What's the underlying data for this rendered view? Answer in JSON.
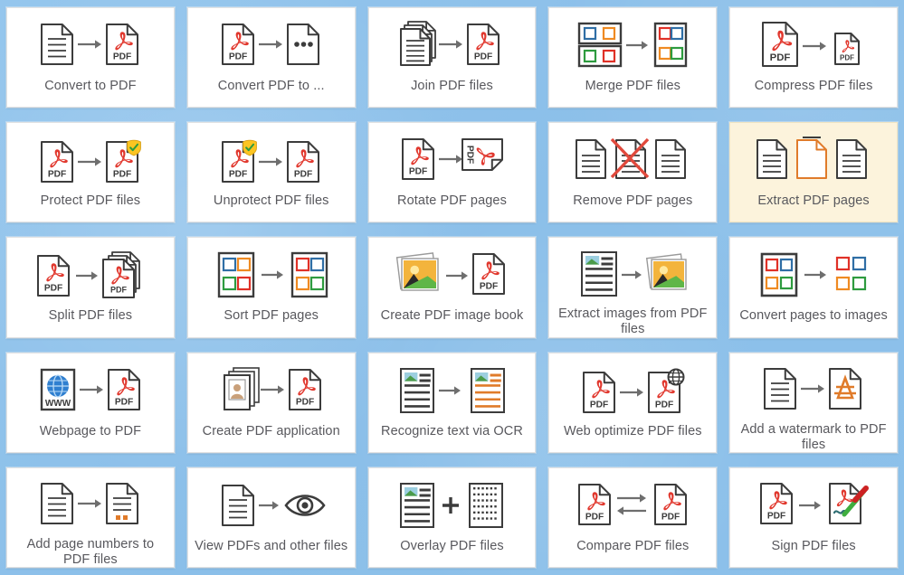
{
  "page": {
    "background_color": "#8cc0ea",
    "tile_background_color": "#ffffff",
    "selected_tile_background_color": "#fcf3dc",
    "label_color": "#58585d",
    "accent_pdf_red": "#e1382e",
    "accent_orange": "#e07b2a",
    "columns": 5,
    "rows": 5
  },
  "tiles": [
    {
      "id": "convert-to-pdf",
      "label": "Convert to PDF",
      "icon": "doc-arrow-pdf",
      "selected": false
    },
    {
      "id": "convert-pdf-to",
      "label": "Convert PDF to ...",
      "icon": "pdf-arrow-dots",
      "selected": false
    },
    {
      "id": "join-pdf-files",
      "label": "Join PDF files",
      "icon": "docstack-arrow-pdf",
      "selected": false
    },
    {
      "id": "merge-pdf-files",
      "label": "Merge PDF files",
      "icon": "grid2-arrow-grid4",
      "selected": false
    },
    {
      "id": "compress-pdf-files",
      "label": "Compress PDF files",
      "icon": "pdf-arrow-smallpdf",
      "selected": false
    },
    {
      "id": "protect-pdf-files",
      "label": "Protect PDF files",
      "icon": "pdf-arrow-pdfshield",
      "selected": false
    },
    {
      "id": "unprotect-pdf-files",
      "label": "Unprotect PDF files",
      "icon": "pdfshield-arrow-pdf",
      "selected": false
    },
    {
      "id": "rotate-pdf-pages",
      "label": "Rotate PDF pages",
      "icon": "pdf-arrow-rotatedpdf",
      "selected": false
    },
    {
      "id": "remove-pdf-pages",
      "label": "Remove PDF pages",
      "icon": "three-docs-crossed",
      "selected": false
    },
    {
      "id": "extract-pdf-pages",
      "label": "Extract PDF pages",
      "icon": "three-docs-middle-orange",
      "selected": true
    },
    {
      "id": "split-pdf-files",
      "label": "Split PDF files",
      "icon": "pdf-arrow-pdfstack",
      "selected": false
    },
    {
      "id": "sort-pdf-pages",
      "label": "Sort PDF pages",
      "icon": "gridpage-arrow-gridpage",
      "selected": false
    },
    {
      "id": "create-pdf-image-book",
      "label": "Create PDF image book",
      "icon": "photos-arrow-pdf",
      "selected": false
    },
    {
      "id": "extract-images-from-pdf",
      "label": "Extract images from PDF files",
      "icon": "article-arrow-photos",
      "selected": false
    },
    {
      "id": "convert-pages-to-images",
      "label": "Convert pages to images",
      "icon": "gridpage-arrow-squares",
      "selected": false
    },
    {
      "id": "webpage-to-pdf",
      "label": "Webpage to PDF",
      "icon": "www-arrow-pdf",
      "selected": false
    },
    {
      "id": "create-pdf-application",
      "label": "Create PDF application",
      "icon": "forms-arrow-pdf",
      "selected": false
    },
    {
      "id": "recognize-text-via-ocr",
      "label": "Recognize text via OCR",
      "icon": "article-arrow-ocr",
      "selected": false
    },
    {
      "id": "web-optimize-pdf-files",
      "label": "Web optimize PDF files",
      "icon": "pdf-arrow-pdfglobe",
      "selected": false
    },
    {
      "id": "add-watermark-to-pdf",
      "label": "Add a watermark to PDF files",
      "icon": "doc-arrow-watermark",
      "selected": false
    },
    {
      "id": "add-page-numbers",
      "label": "Add page numbers to PDF files",
      "icon": "doc-arrow-numbered",
      "selected": false
    },
    {
      "id": "view-pdfs-and-other",
      "label": "View PDFs and other files",
      "icon": "doc-arrow-eye",
      "selected": false
    },
    {
      "id": "overlay-pdf-files",
      "label": "Overlay PDF files",
      "icon": "article-plus-dots",
      "selected": false
    },
    {
      "id": "compare-pdf-files",
      "label": "Compare PDF files",
      "icon": "pdf-twoarrows-pdf",
      "selected": false
    },
    {
      "id": "sign-pdf-files",
      "label": "Sign PDF files",
      "icon": "pdf-arrow-signedpdf",
      "selected": false
    }
  ]
}
